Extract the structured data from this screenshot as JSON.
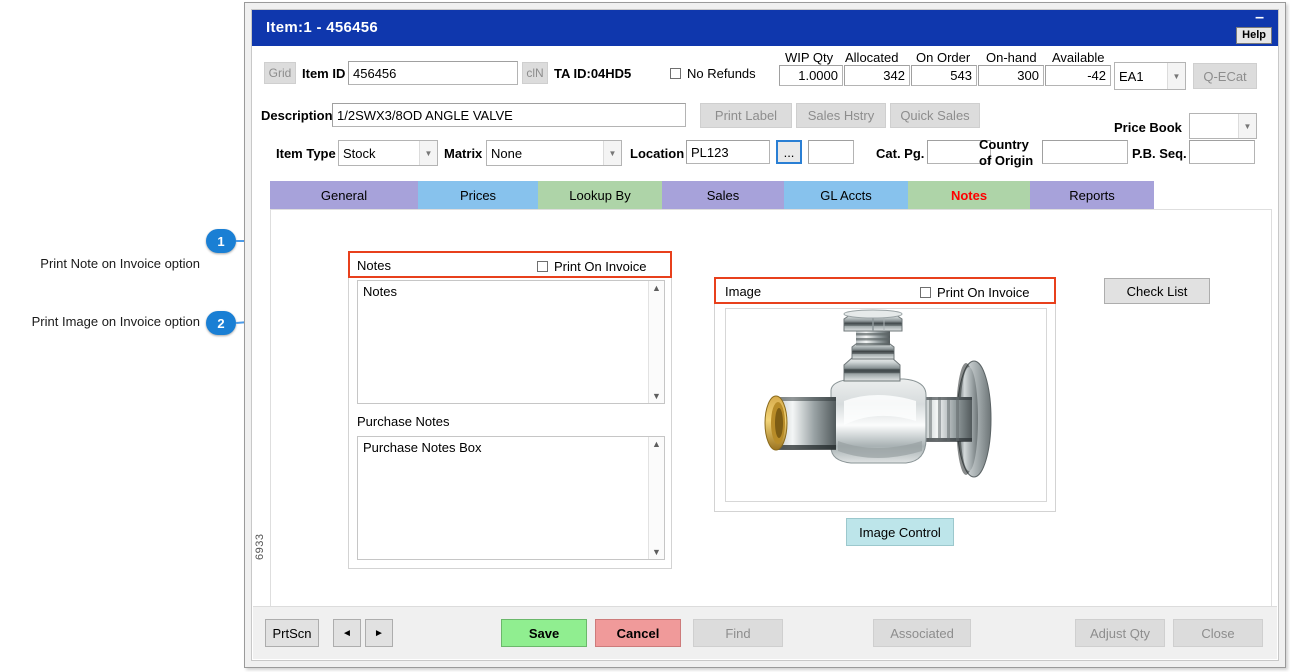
{
  "annotations": [
    {
      "num": "1",
      "label": "Print Note on Invoice option"
    },
    {
      "num": "2",
      "label": "Print Image on Invoice option"
    }
  ],
  "window": {
    "title": "Item:1 - 456456",
    "minimize_glyph": "–",
    "help_label": "Help",
    "side_code": "6933"
  },
  "header": {
    "grid_button": "Grid",
    "item_id_label": "Item ID",
    "item_id_value": "456456",
    "cln_button": "clN",
    "ta_id_label": "TA ID:04HD5",
    "no_refunds_label": "No Refunds",
    "description_label": "Description",
    "description_value": "1/2SWX3/8OD ANGLE VALVE",
    "print_label_button": "Print Label",
    "sales_hstry_button": "Sales Hstry",
    "quick_sales_button": "Quick Sales",
    "item_type_label": "Item Type",
    "item_type_value": "Stock",
    "matrix_label": "Matrix",
    "matrix_value": "None",
    "location_label": "Location",
    "location_value": "PL123",
    "browse_button": "...",
    "location_extra_value": "",
    "cat_pg_label": "Cat. Pg.",
    "cat_pg_value": "",
    "country_label_line1": "Country",
    "country_label_line2": "of Origin",
    "country_value": "",
    "price_book_label": "Price Book",
    "price_book_value": "",
    "pb_seq_label": "P.B. Seq.",
    "pb_seq_value": ""
  },
  "quantities": [
    {
      "label": "WIP Qty",
      "value": "1.0000"
    },
    {
      "label": "Allocated",
      "value": "342"
    },
    {
      "label": "On Order",
      "value": "543"
    },
    {
      "label": "On-hand",
      "value": "300"
    },
    {
      "label": "Available",
      "value": "-42"
    }
  ],
  "uom": {
    "value": "EA1"
  },
  "qecat_button": "Q-ECat",
  "tabs": [
    {
      "label": "General",
      "color": "#a7a2da",
      "active": false
    },
    {
      "label": "Prices",
      "color": "#87c2ed",
      "active": false
    },
    {
      "label": "Lookup By",
      "color": "#aed4a8",
      "active": false
    },
    {
      "label": "Sales",
      "color": "#a7a2da",
      "active": false
    },
    {
      "label": "GL Accts",
      "color": "#87c2ed",
      "active": false
    },
    {
      "label": "Notes",
      "color": "#aed4a8",
      "active": true
    },
    {
      "label": "Reports",
      "color": "#a7a2da",
      "active": false
    }
  ],
  "tab_active_text_color": "#ff0000",
  "notes_panel": {
    "group_title": "Notes",
    "print_on_invoice_label": "Print On Invoice",
    "notes_value": "Notes",
    "purchase_notes_label": "Purchase Notes",
    "purchase_notes_value": "Purchase Notes Box"
  },
  "image_panel": {
    "group_title": "Image",
    "print_on_invoice_label": "Print On Invoice",
    "image_alt": "angle-valve-photo",
    "image_control_button": "Image Control",
    "image_control_color": "#bde5ea"
  },
  "check_list_button": "Check List",
  "footer": {
    "prtscn": "PrtScn",
    "prev_glyph": "◄",
    "next_glyph": "►",
    "save": "Save",
    "save_color": "#90ee90",
    "cancel": "Cancel",
    "cancel_color": "#f09a9a",
    "find": "Find",
    "associated": "Associated",
    "adjust_qty": "Adjust Qty",
    "close": "Close"
  },
  "highlight_color": "#e8401c",
  "accent_blue": "#1a7fd4",
  "title_bar_color": "#0f37ad"
}
